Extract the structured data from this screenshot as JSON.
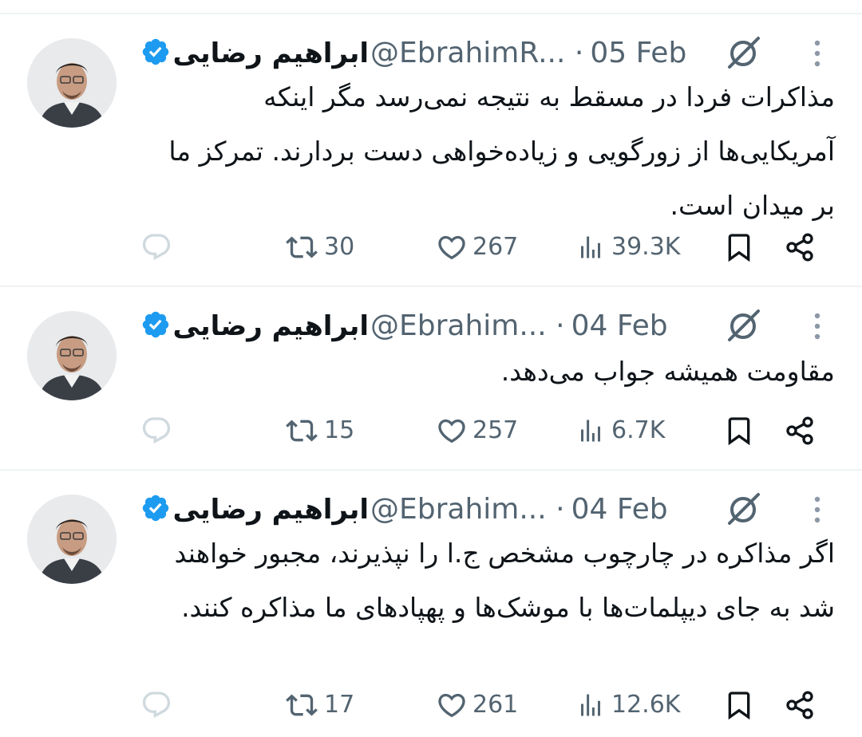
{
  "colors": {
    "accent": "#1d9bf0",
    "muted": "#536471",
    "text": "#0f1419",
    "divider": "#eff3f4"
  },
  "icons": {
    "verified": "verified-badge-icon",
    "grok": "grok-icon",
    "more": "more-vertical-icon",
    "reply": "reply-icon",
    "retweet": "retweet-icon",
    "like": "heart-icon",
    "views": "views-icon",
    "bookmark": "bookmark-icon",
    "share": "share-icon"
  },
  "tweets": [
    {
      "name": "ابراهیم رضایی",
      "handle": "@EbrahimR...",
      "separator": "·",
      "date": "05 Feb",
      "text": "مذاکرات فردا در مسقط به نتیجه نمی‌رسد مگر اینکه آمریکایی‌ها از زورگویی و زیاده‌خواهی دست بردارند. تمرکز ما بر میدان است.",
      "retweets": "30",
      "likes": "267",
      "views": "39.3K"
    },
    {
      "name": "ابراهیم رضایی",
      "handle": "@Ebrahim...",
      "separator": "·",
      "date": "04 Feb",
      "text": "مقاومت همیشه جواب می‌دهد.",
      "retweets": "15",
      "likes": "257",
      "views": "6.7K"
    },
    {
      "name": "ابراهیم رضایی",
      "handle": "@Ebrahim...",
      "separator": "·",
      "date": "04 Feb",
      "text": "اگر مذاکره در چارچوب مشخص ج.ا را نپذیرند، مجبور خواهند شد به جای دیپلمات‌ها با موشک‌ها و پهپادهای ما مذاکره کنند.",
      "retweets": "17",
      "likes": "261",
      "views": "12.6K"
    }
  ]
}
